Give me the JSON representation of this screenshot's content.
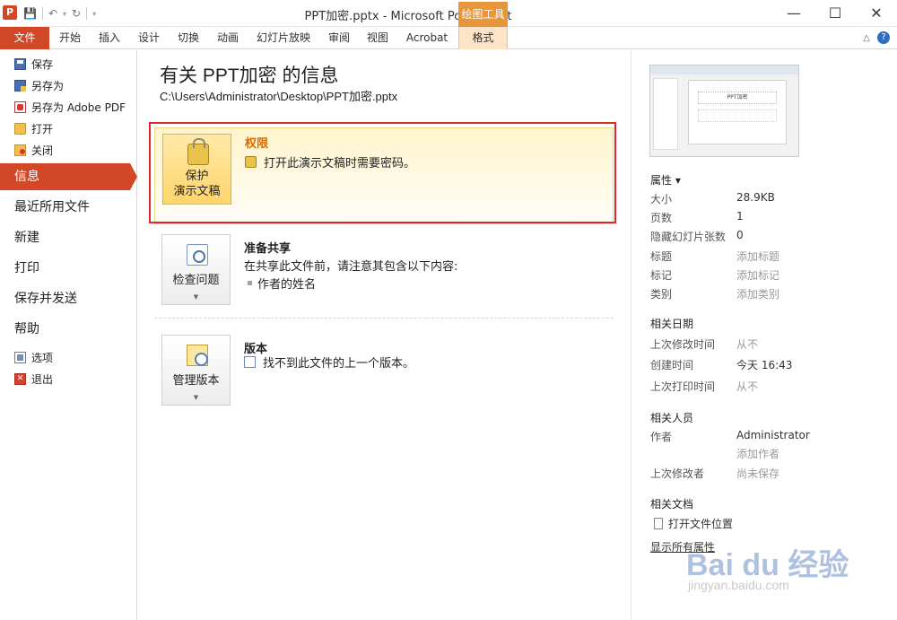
{
  "window": {
    "title": "PPT加密.pptx - Microsoft PowerPoint",
    "app_icon_letter": "P",
    "controls": [
      "—",
      "☐",
      "✕"
    ],
    "tool_group": "绘图工具"
  },
  "qat": {
    "save": "💾",
    "undo": "↶",
    "redo": "↻",
    "customize": "▾"
  },
  "ribbon": {
    "file_tab": "文件",
    "tabs": [
      "开始",
      "插入",
      "设计",
      "切换",
      "动画",
      "幻灯片放映",
      "审阅",
      "视图",
      "Acrobat"
    ],
    "format_tab": "格式",
    "minimize": "△",
    "help": "?"
  },
  "nav": {
    "save": "保存",
    "save_as": "另存为",
    "save_pdf": "另存为 Adobe PDF",
    "open": "打开",
    "close": "关闭",
    "info": "信息",
    "recent": "最近所用文件",
    "new": "新建",
    "print": "打印",
    "save_send": "保存并发送",
    "help": "帮助",
    "options": "选项",
    "exit": "退出",
    "exit_icon": "✕"
  },
  "main": {
    "title": "有关 PPT加密 的信息",
    "path": "C:\\Users\\Administrator\\Desktop\\PPT加密.pptx",
    "permissions": {
      "button_line1": "保护",
      "button_line2": "演示文稿",
      "heading": "权限",
      "text": "打开此演示文稿时需要密码。"
    },
    "sharing": {
      "button": "检查问题",
      "heading": "准备共享",
      "text": "在共享此文件前，请注意其包含以下内容:",
      "item": "作者的姓名"
    },
    "versions": {
      "button": "管理版本",
      "heading": "版本",
      "text": "找不到此文件的上一个版本。"
    },
    "arrow": "▼"
  },
  "preview": {
    "slide_title": "PPT加密"
  },
  "properties": {
    "heading": "属性 ▾",
    "rows": [
      {
        "key": "大小",
        "value": "28.9KB"
      },
      {
        "key": "页数",
        "value": "1"
      },
      {
        "key": "隐藏幻灯片张数",
        "value": "0"
      },
      {
        "key": "标题",
        "value": "添加标题"
      },
      {
        "key": "标记",
        "value": "添加标记"
      },
      {
        "key": "类别",
        "value": "添加类别"
      }
    ],
    "dates_heading": "相关日期",
    "dates": [
      {
        "key": "上次修改时间",
        "value": "从不"
      },
      {
        "key": "创建时间",
        "value": "今天 16:43"
      },
      {
        "key": "上次打印时间",
        "value": "从不"
      }
    ],
    "people_heading": "相关人员",
    "author_key": "作者",
    "author_value": "Administrator",
    "add_author": "添加作者",
    "last_modified_by_key": "上次修改者",
    "last_modified_by_value": "尚未保存",
    "docs_heading": "相关文档",
    "open_location": "打开文件位置",
    "show_all": "显示所有属性"
  },
  "watermark": {
    "logo": "Bai du 经验",
    "sub": "jingyan.baidu.com"
  }
}
